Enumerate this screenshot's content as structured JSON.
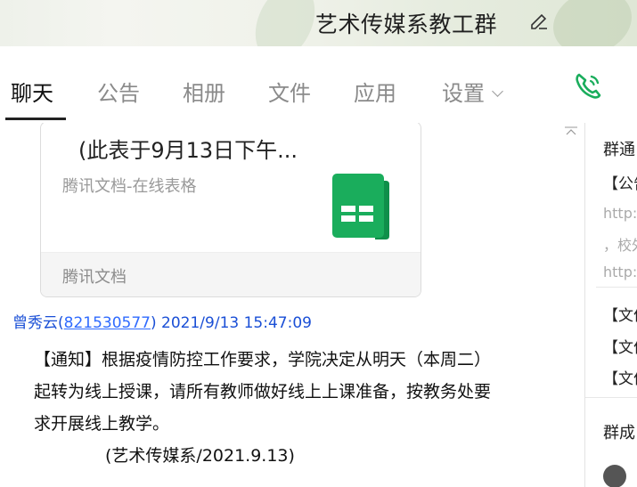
{
  "window": {
    "title": "艺术传媒系教工群"
  },
  "tabs": [
    {
      "label": "聊天",
      "active": true
    },
    {
      "label": "公告",
      "active": false
    },
    {
      "label": "相册",
      "active": false
    },
    {
      "label": "文件",
      "active": false
    },
    {
      "label": "应用",
      "active": false
    },
    {
      "label": "设置",
      "active": false
    }
  ],
  "doc_card": {
    "title": "(此表于9月13日下午...",
    "subtitle": "腾讯文档-在线表格",
    "footer": "腾讯文档"
  },
  "message": {
    "sender_name": "曾秀云",
    "sender_qq": "821530577",
    "timestamp": "2021/9/13 15:47:09",
    "lines": [
      "【通知】根据疫情防控工作要求，学院决定从明天（本周二）",
      "起转为线上授课，请所有教师做好线上上课准备，按教务处要",
      "求开展线上教学。"
    ],
    "signature": "(艺术传媒系/2021.9.13)"
  },
  "side_panel": {
    "notice_title": "群通",
    "notice_item": "【公告",
    "link1": "http:/",
    "text1": "，校外",
    "link2": "http:/",
    "file1": "【文件",
    "file2": "【文件",
    "file3": "【文件",
    "members_title": "群成"
  },
  "colors": {
    "accent_green": "#1aad5c",
    "link_blue": "#2f6bff"
  }
}
